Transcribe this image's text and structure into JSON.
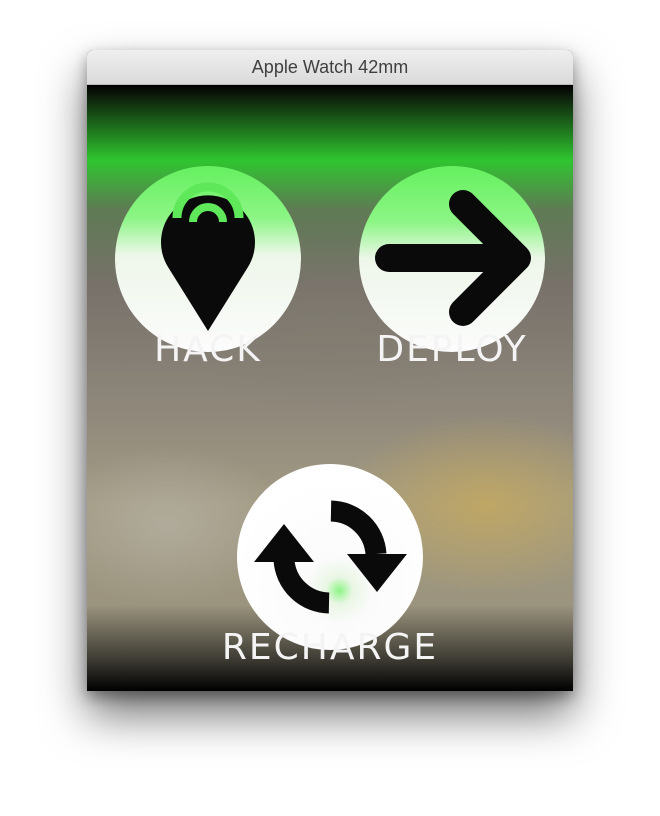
{
  "window": {
    "title": "Apple Watch 42mm"
  },
  "actions": {
    "hack": {
      "label": "HACK",
      "icon": "map-pin-signal-icon"
    },
    "deploy": {
      "label": "DEPLOY",
      "icon": "arrow-right-icon"
    },
    "recharge": {
      "label": "RECHARGE",
      "icon": "refresh-arrows-icon"
    }
  },
  "colors": {
    "accent_green": "#55e650",
    "icon_black": "#0a0a0a",
    "circle_white": "#fafafa",
    "label_text": "#f4f4f4"
  }
}
